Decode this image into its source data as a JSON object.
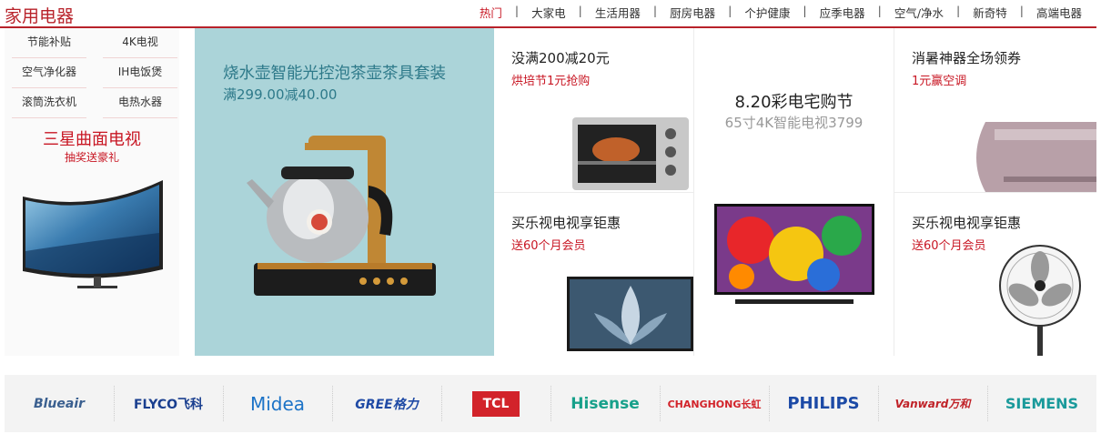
{
  "header": {
    "title": "家用电器",
    "tabs": [
      "热门",
      "大家电",
      "生活用器",
      "厨房电器",
      "个护健康",
      "应季电器",
      "空气/净水",
      "新奇特",
      "高端电器"
    ]
  },
  "left": {
    "categories": [
      "节能补贴",
      "4K电视",
      "空气净化器",
      "IH电饭煲",
      "滚筒洗衣机",
      "电热水器"
    ],
    "promo_title": "三星曲面电视",
    "promo_subtitle": "抽奖送豪礼"
  },
  "feature": {
    "title": "烧水壶智能光控泡茶壶茶具套装",
    "subtitle": "满299.00减40.00"
  },
  "grid": {
    "oven": {
      "title": "没满200减20元",
      "subtitle": "烘培节1元抢购"
    },
    "center": {
      "title": "8.20彩电宅购节",
      "subtitle": "65寸4K智能电视3799"
    },
    "ac": {
      "title": "消暑神器全场领券",
      "subtitle": "1元赢空调"
    },
    "tv1": {
      "title": "买乐视电视享钜惠",
      "subtitle": "送60个月会员"
    },
    "fan": {
      "title": "买乐视电视享钜惠",
      "subtitle": "送60个月会员"
    }
  },
  "brands": [
    {
      "name": "Blueair",
      "color": "#3a5f8f"
    },
    {
      "name": "FLYCO飞科",
      "color": "#1a3f8f"
    },
    {
      "name": "Midea",
      "color": "#1c73c7"
    },
    {
      "name": "GREE格力",
      "color": "#1f4aa5"
    },
    {
      "name": "TCL",
      "color": "#ffffff"
    },
    {
      "name": "Hisense",
      "color": "#17a08a"
    },
    {
      "name": "CHANGHONG长虹",
      "color": "#d2232a"
    },
    {
      "name": "PHILIPS",
      "color": "#1c4aa6"
    },
    {
      "name": "Vanward万和",
      "color": "#c02228"
    },
    {
      "name": "SIEMENS",
      "color": "#1a9a9b"
    }
  ]
}
